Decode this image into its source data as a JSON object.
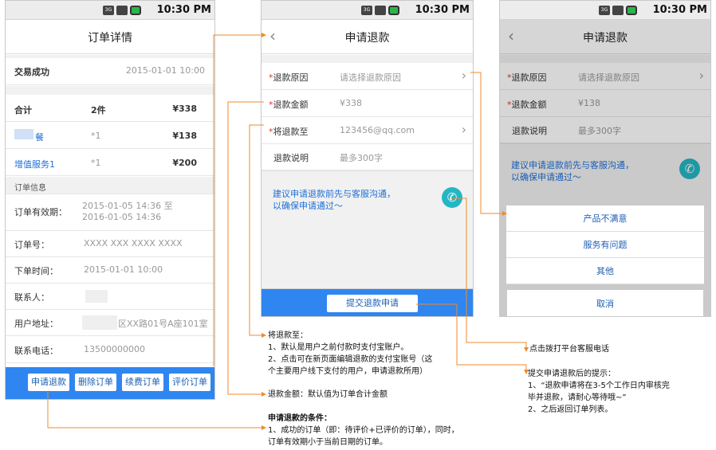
{
  "status": {
    "time": "10:30 PM",
    "net": "3G"
  },
  "order": {
    "title": "订单详情",
    "trade_status": "交易成功",
    "trade_time": "2015-01-01 10:00",
    "total_label": "合计",
    "total_count": "2件",
    "total_price": "¥338",
    "items": [
      {
        "name": "餐",
        "qty": "*1",
        "price": "¥138"
      },
      {
        "name": "增值服务1",
        "qty": "*1",
        "price": "¥200"
      }
    ],
    "section_info": "订单信息",
    "fields": [
      {
        "label": "订单有效期：",
        "value": "2015-01-05 14:36 至",
        "value2": "2016-01-05 14:36"
      },
      {
        "label": "订单号：",
        "value": "XXXX XXX XXXX XXXX"
      },
      {
        "label": "下单时间：",
        "value": "2015-01-01 10:00"
      },
      {
        "label": "联系人：",
        "value": ""
      },
      {
        "label": "用户地址：",
        "value": "区XX路01号A座101室"
      },
      {
        "label": "联系电话：",
        "value": "13500000000"
      }
    ],
    "buttons": [
      "申请退款",
      "删除订单",
      "续费订单",
      "评价订单"
    ]
  },
  "refund": {
    "title": "申请退款",
    "back": "‹",
    "reason_label": "退款原因",
    "reason_placeholder": "请选择退款原因",
    "amount_label": "退款金额",
    "amount_value": "¥338",
    "to_label": "将退款至",
    "to_value": "123456@qq.com",
    "note_label": "退款说明",
    "note_placeholder": "最多300字",
    "tip_line1": "建议申请退款前先与客服沟通，",
    "tip_line2": "以确保申请通过～",
    "submit": "提交退款申请",
    "star": "*"
  },
  "refund_sheet": {
    "title": "申请退款",
    "amount_value": "¥138",
    "options": [
      "产品不满意",
      "服务有问题",
      "其他"
    ],
    "cancel": "取消"
  },
  "annotations": {
    "to_account": {
      "title": "将退款至：",
      "line1": "1、默认是用户之前付款时支付宝账户。",
      "line2": "2、点击可在新页面编辑退款的支付宝账号（这",
      "line3": "个主要用户线下支付的用户，申请退款所用）"
    },
    "amount": "退款金额：默认值为订单合计金额",
    "conditions": {
      "title": "申请退款的条件：",
      "line1": "1、成功的订单（即：待评价+已评价的订单），同时，",
      "line2": "订单有效期小于当前日期的订单。"
    },
    "call": "点击拨打平台客服电话",
    "submit_tip": {
      "title": "提交申请退款后的提示：",
      "line1": "1、“退款申请将在3-5个工作日内审核完",
      "line2": "毕并退款，请耐心等待哦~”",
      "line3": "2、之后返回订单列表。"
    }
  },
  "colors": {
    "accent": "#2f86f0",
    "link": "#1d6fd8",
    "required": "#d9362b",
    "connector": "#f08a2c",
    "phone_icon": "#25b6c4"
  }
}
